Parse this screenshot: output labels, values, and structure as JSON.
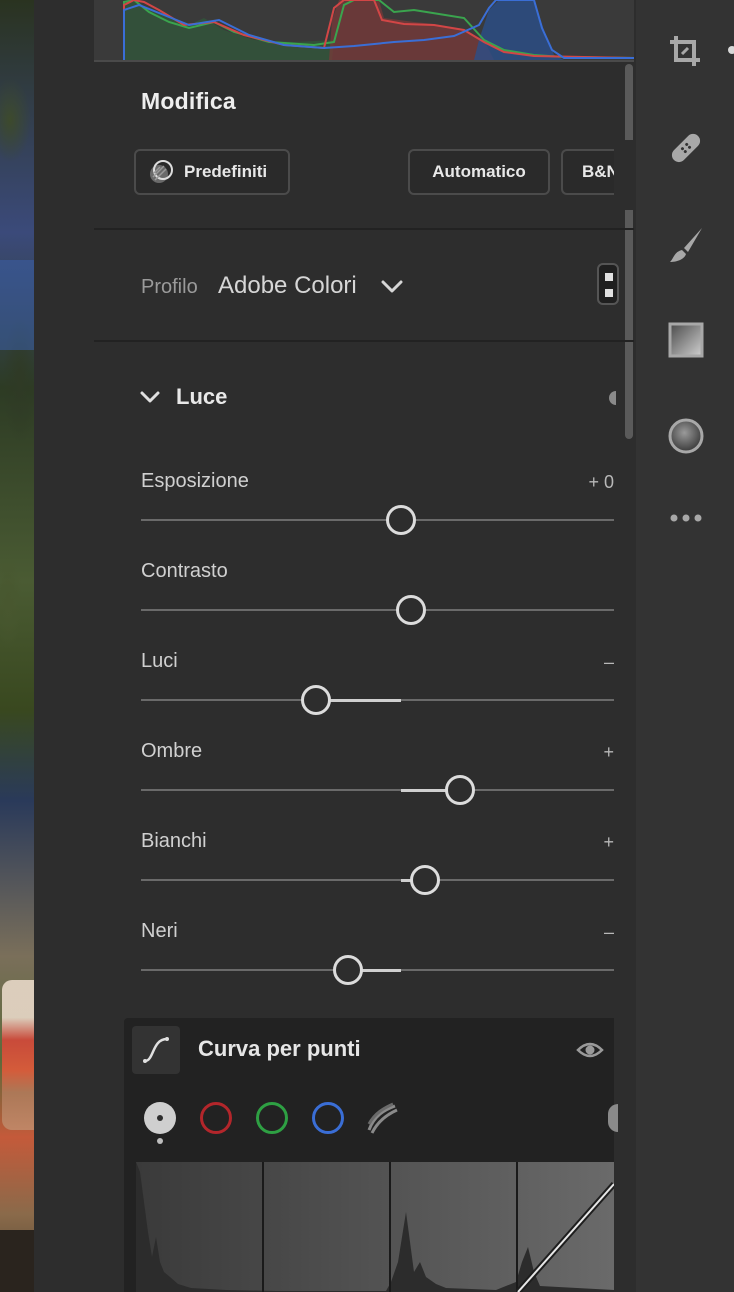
{
  "header": {
    "title": "Modifica",
    "presets_label": "Predefiniti",
    "auto_label": "Automatico",
    "bw_label": "B&N"
  },
  "profile": {
    "label": "Profilo",
    "value": "Adobe Colori"
  },
  "light": {
    "title": "Luce",
    "sliders": [
      {
        "name": "exposure",
        "label": "Esposizione",
        "value_text": "+ 0",
        "position": 0.547
      },
      {
        "name": "contrast",
        "label": "Contrasto",
        "value_text": "",
        "position": 0.568
      },
      {
        "name": "highlights",
        "label": "Luci",
        "value_text": "–",
        "position": 0.368
      },
      {
        "name": "shadows",
        "label": "Ombre",
        "value_text": "+",
        "position": 0.672
      },
      {
        "name": "whites",
        "label": "Bianchi",
        "value_text": "+",
        "position": 0.598
      },
      {
        "name": "blacks",
        "label": "Neri",
        "value_text": "–",
        "position": 0.436
      }
    ]
  },
  "point_curve": {
    "title": "Curva per punti",
    "channels": [
      "rgb",
      "red",
      "green",
      "blue",
      "parametric"
    ]
  },
  "toolbar": {
    "tools": [
      "crop-icon",
      "healing-icon",
      "brush-icon",
      "linear-gradient-icon",
      "radial-gradient-icon",
      "more-icon"
    ]
  },
  "colors": {
    "panel_bg": "#2d2d2d",
    "toolbar_bg": "#333333",
    "red_channel": "#b3262b",
    "green_channel": "#2ea043",
    "blue_channel": "#3a6ed6"
  }
}
